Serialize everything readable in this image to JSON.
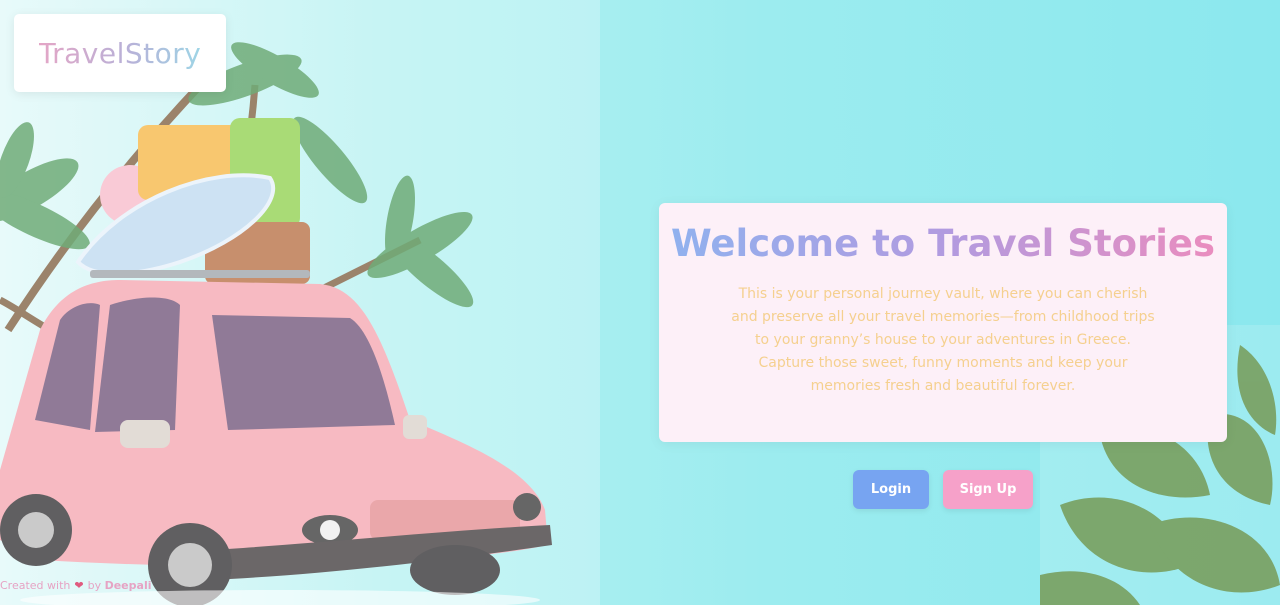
{
  "logo": {
    "text": "TravelStory"
  },
  "welcome": {
    "title": "Welcome to Travel Stories",
    "description": "This is your personal journey vault, where you can cherish and preserve all your travel memories—from childhood trips to your granny’s house to your adventures in Greece. Capture those sweet, funny moments and keep your memories fresh and beautiful forever."
  },
  "buttons": {
    "login": "Login",
    "signup": "Sign Up"
  },
  "footer": {
    "prefix": "Created with",
    "heart": "❤",
    "by": "by",
    "author": "Deepali"
  },
  "illustration": {
    "subject": "pink cartoon car with suitcases and surfboard on roof, palm trees",
    "decor_right": "monstera plant leaves"
  },
  "colors": {
    "background_left": "#e0f8f8",
    "background_right": "#8be8ee",
    "card_bg": "#fdf0f8",
    "title_gradient_start": "#8fb2ef",
    "title_gradient_end": "#ec8cbd",
    "description_text": "#f5d08f",
    "login_button": "#77a4f1",
    "signup_button": "#f6a1c9"
  }
}
